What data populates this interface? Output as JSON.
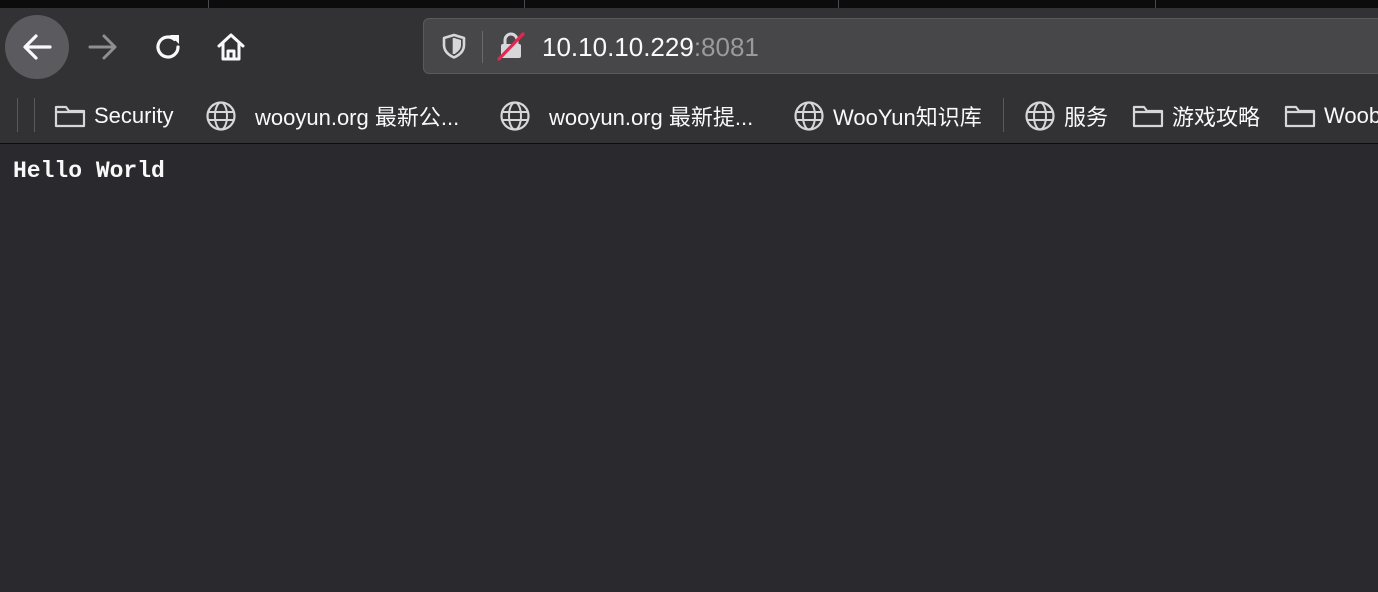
{
  "toolbar": {
    "back_icon": "arrow-left-icon",
    "forward_icon": "arrow-right-icon",
    "reload_icon": "reload-icon",
    "home_icon": "home-icon"
  },
  "urlbar": {
    "host": "10.10.10.229",
    "port": ":8081",
    "tracking_icon": "shield-icon",
    "insecure_icon": "insecure-lock-icon"
  },
  "bookmarks": [
    {
      "label": "Security",
      "icon": "folder-icon"
    },
    {
      "label": "wooyun.org 最新公...",
      "icon": "globe-icon"
    },
    {
      "label": "wooyun.org 最新提...",
      "icon": "globe-icon"
    },
    {
      "label": "WooYun知识库",
      "icon": "globe-icon"
    },
    {
      "label": "服务",
      "icon": "globe-icon"
    },
    {
      "label": "游戏攻略",
      "icon": "folder-icon"
    },
    {
      "label": "Woob",
      "icon": "folder-icon"
    }
  ],
  "page": {
    "text": "Hello World"
  },
  "colors": {
    "chrome": "#323234",
    "content_bg": "#2a2a2e",
    "insecure_slash": "#e22850"
  }
}
